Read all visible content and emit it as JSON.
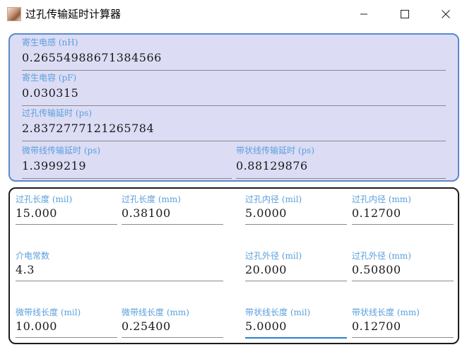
{
  "window": {
    "title": "过孔传输延时计算器",
    "app_icon": "app-photo-icon",
    "controls": {
      "minimize": "minimize-icon",
      "maximize": "maximize-icon",
      "close": "close-icon"
    }
  },
  "results": {
    "parasitic_inductance": {
      "label": "寄生电感 (nH)",
      "value": "0.26554988671384566"
    },
    "parasitic_capacitance": {
      "label": "寄生电容 (pF)",
      "value": "0.030315"
    },
    "via_delay": {
      "label": "过孔传输延时 (ps)",
      "value": "2.8372777121265784"
    },
    "microstrip_delay": {
      "label": "微带线传输延时 (ps)",
      "value": "1.3999219"
    },
    "stripline_delay": {
      "label": "带状线传输延时 (ps)",
      "value": "0.88129876"
    }
  },
  "inputs": {
    "via_length_mil": {
      "label": "过孔长度 (mil)",
      "value": "15.000"
    },
    "via_length_mm": {
      "label": "过孔长度 (mm)",
      "value": "0.38100"
    },
    "via_inner_mil": {
      "label": "过孔内径 (mil)",
      "value": "5.0000"
    },
    "via_inner_mm": {
      "label": "过孔内径 (mm)",
      "value": "0.12700"
    },
    "dielectric": {
      "label": "介电常数",
      "value": "4.3"
    },
    "via_outer_mil": {
      "label": "过孔外径 (mil)",
      "value": "20.000"
    },
    "via_outer_mm": {
      "label": "过孔外径 (mm)",
      "value": "0.50800"
    },
    "microstrip_len_mil": {
      "label": "微带线长度 (mil)",
      "value": "10.000"
    },
    "microstrip_len_mm": {
      "label": "微带线长度 (mm)",
      "value": "0.25400"
    },
    "stripline_len_mil": {
      "label": "带状线长度 (mil)",
      "value": "5.0000"
    },
    "stripline_len_mm": {
      "label": "带状线长度 (mm)",
      "value": "0.12700"
    }
  },
  "colors": {
    "label": "#5aa0dc",
    "top_panel_bg": "#dcdcf5",
    "top_panel_border": "#5b8ac9",
    "bottom_panel_border": "#1c1c1c",
    "active_underline": "#2f7fd0"
  }
}
